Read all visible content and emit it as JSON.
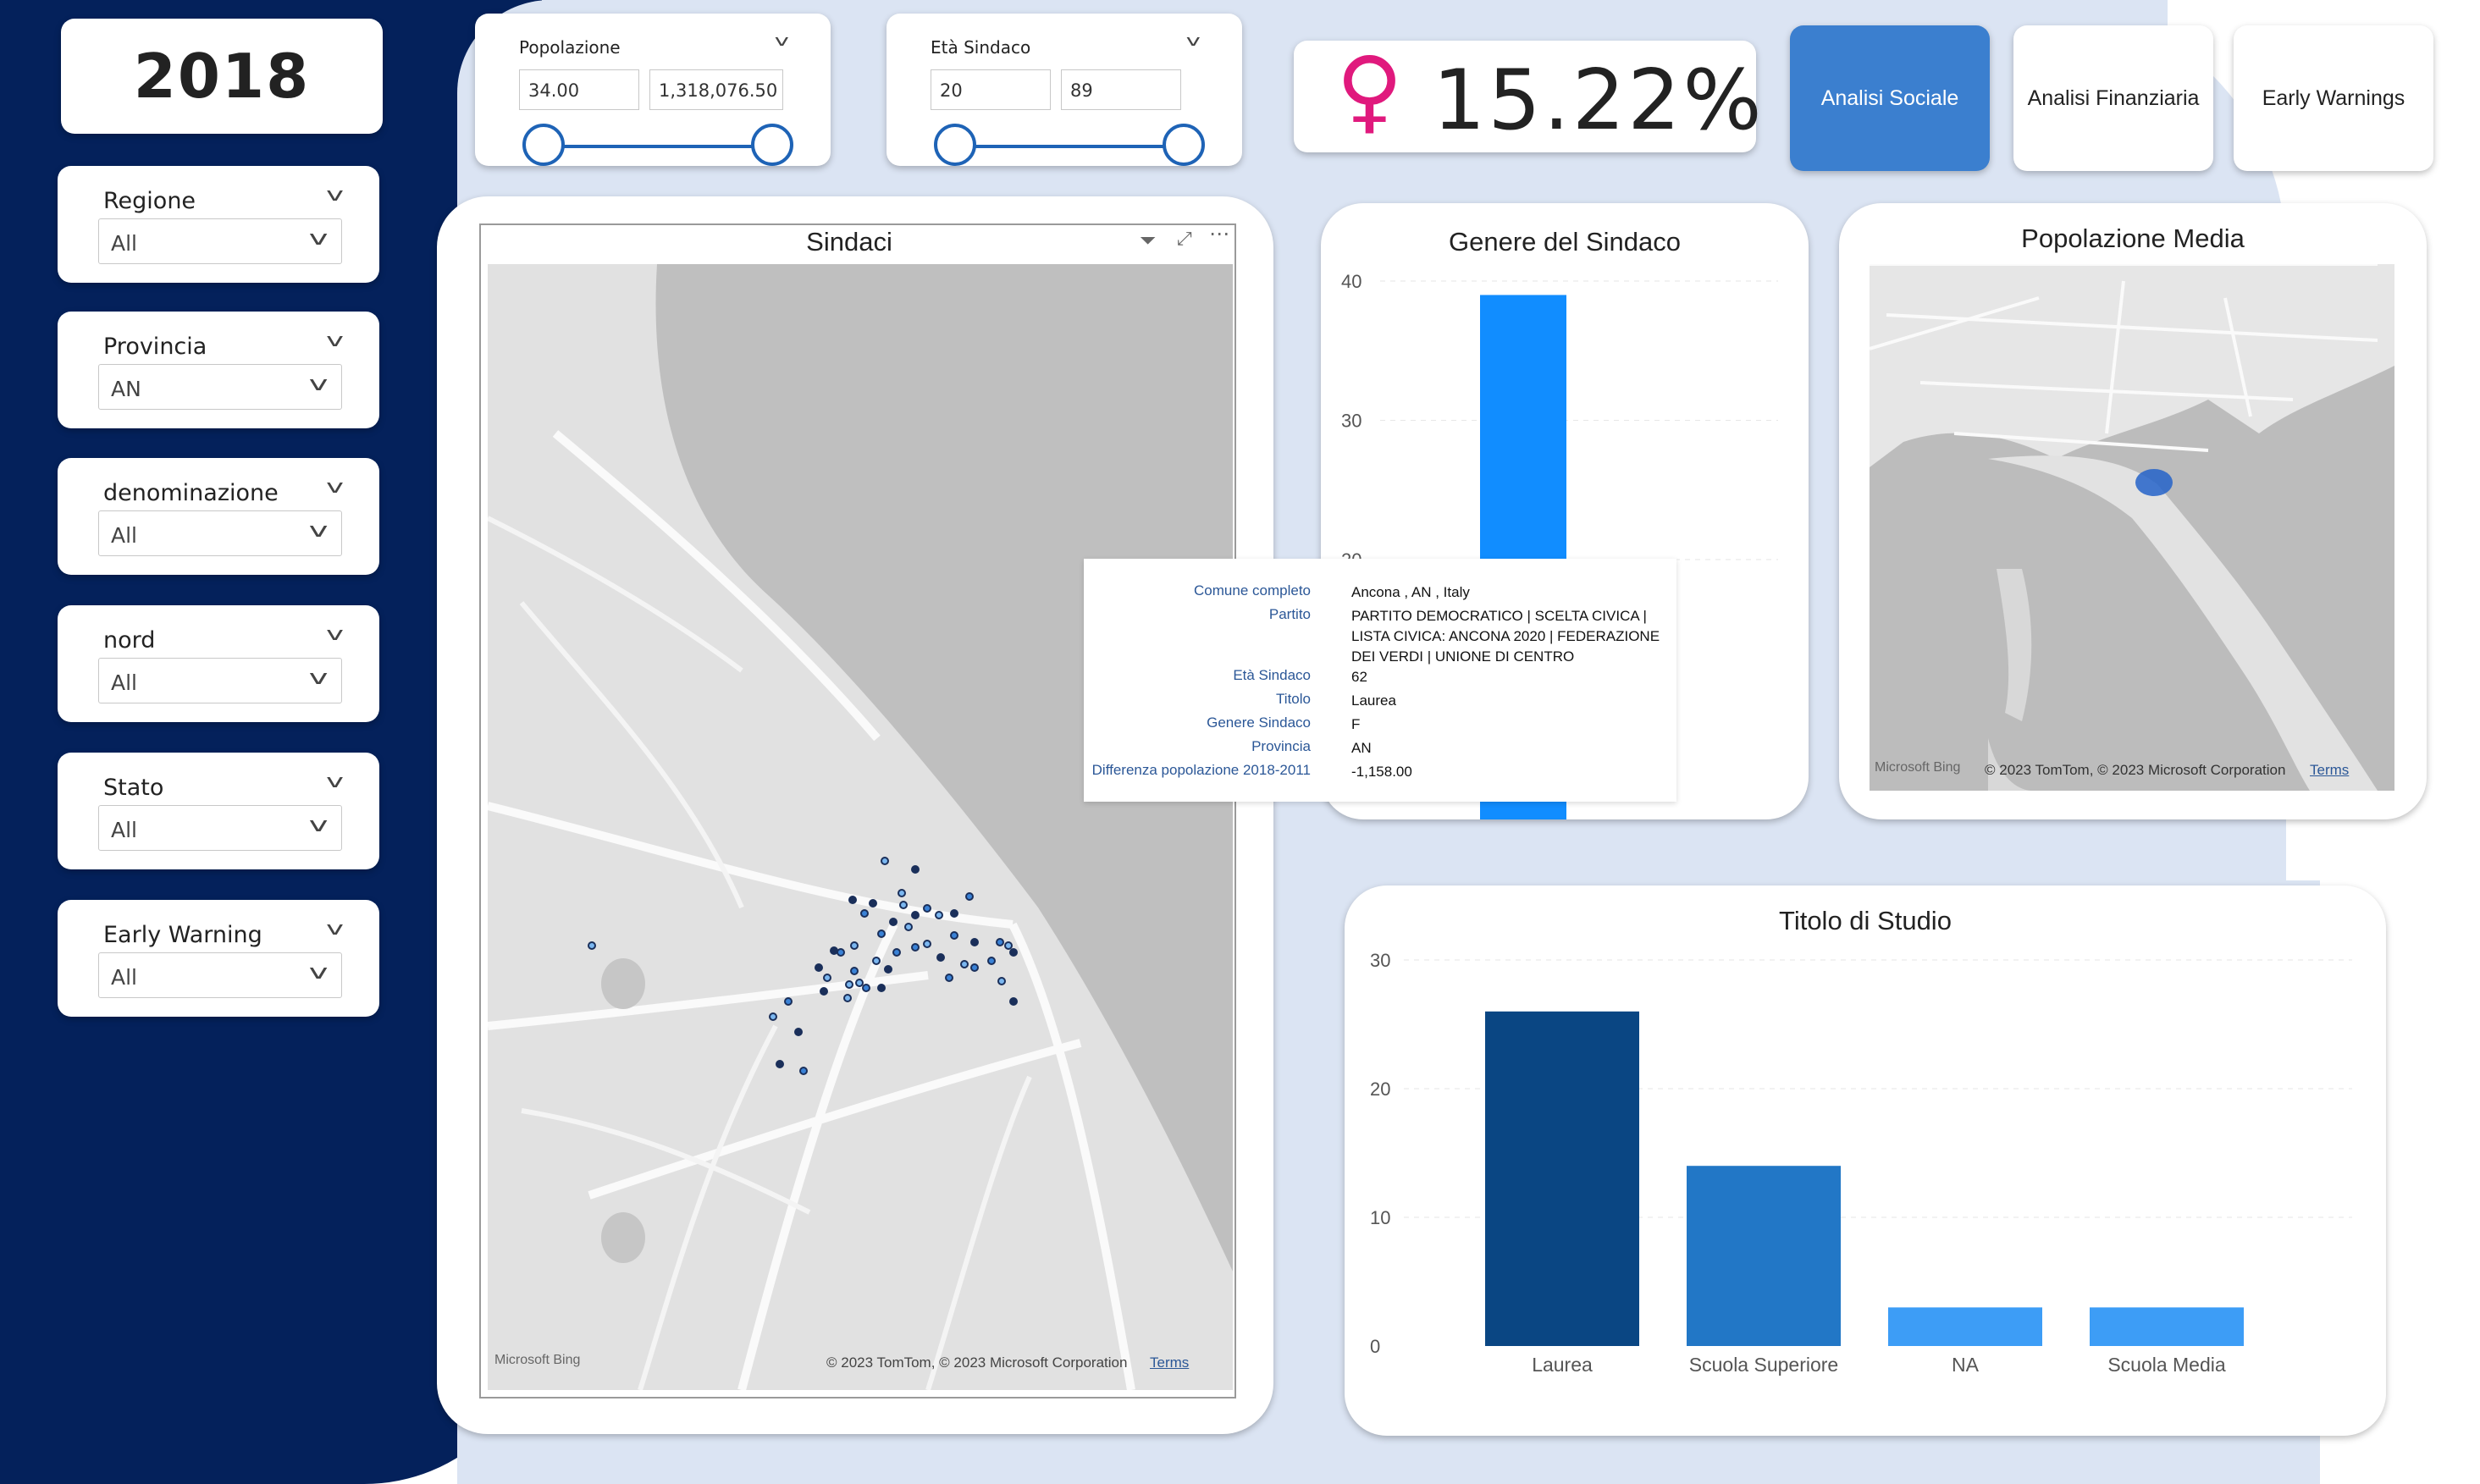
{
  "year": "2018",
  "slicers": [
    {
      "label": "Regione",
      "value": "All"
    },
    {
      "label": "Provincia",
      "value": "AN"
    },
    {
      "label": "denominazione",
      "value": "All"
    },
    {
      "label": "nord",
      "value": "All"
    },
    {
      "label": "Stato",
      "value": "All"
    },
    {
      "label": "Early Warning",
      "value": "All"
    }
  ],
  "popolazione": {
    "label": "Popolazione",
    "min": "34.00",
    "max": "1,318,076.50"
  },
  "eta": {
    "label": "Età Sindaco",
    "min": "20",
    "max": "89"
  },
  "kpi": {
    "symbol": "♀",
    "value": "15.22%",
    "symbol_color": "#e0197d"
  },
  "nav": {
    "social": "Analisi Sociale",
    "finance": "Analisi Finanziaria",
    "warnings": "Early Warnings",
    "active_color": "#3b7fcf"
  },
  "map_sindaci": {
    "title": "Sindaci",
    "bing": "Microsoft Bing",
    "copyright": "© 2023 TomTom, © 2023 Microsoft Corporation",
    "terms": "Terms"
  },
  "map_pop": {
    "title": "Popolazione Media",
    "bing": "Microsoft Bing",
    "copyright": "© 2023 TomTom, © 2023 Microsoft Corporation",
    "terms": "Terms"
  },
  "tooltip": {
    "rows": [
      {
        "k": "Comune completo",
        "v": "Ancona , AN , Italy"
      },
      {
        "k": "Partito",
        "v": "PARTITO DEMOCRATICO | SCELTA CIVICA | LISTA CIVICA: ANCONA 2020 | FEDERAZIONE DEI VERDI | UNIONE DI CENTRO"
      },
      {
        "k": "Età Sindaco",
        "v": "62"
      },
      {
        "k": "Titolo",
        "v": "Laurea"
      },
      {
        "k": "Genere Sindaco",
        "v": "F"
      },
      {
        "k": "Provincia",
        "v": "AN"
      },
      {
        "k": "Differenza popolazione 2018-2011",
        "v": "-1,158.00"
      }
    ]
  },
  "chart_data": [
    {
      "type": "bar",
      "title": "Genere del Sindaco",
      "yticks": [
        "40",
        "30",
        "20"
      ],
      "ylim": [
        0,
        40
      ],
      "values": [
        39
      ],
      "color": "#118dff"
    },
    {
      "type": "bar",
      "title": "Titolo di Studio",
      "categories": [
        "Laurea",
        "Scuola Superiore",
        "NA",
        "Scuola Media"
      ],
      "values": [
        26,
        14,
        3,
        3
      ],
      "colors": [
        "#0a4683",
        "#2277c6",
        "#3d9df6",
        "#3d9df6"
      ],
      "yticks": [
        "30",
        "20",
        "10",
        "0"
      ],
      "ylim": [
        0,
        30
      ]
    }
  ]
}
